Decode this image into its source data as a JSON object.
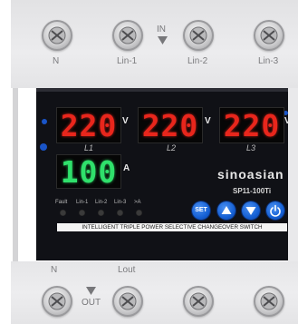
{
  "top_terminals": [
    {
      "label": "N"
    },
    {
      "label": "Lin-1"
    },
    {
      "label": "Lin-2"
    },
    {
      "label": "Lin-3"
    }
  ],
  "input_marker": "IN",
  "displays": {
    "l1": {
      "value": "220",
      "unit": "V",
      "label": "L1"
    },
    "l2": {
      "value": "220",
      "unit": "V",
      "label": "L2"
    },
    "l3": {
      "value": "220",
      "unit": "V",
      "label": "L3"
    },
    "current": {
      "value": "100",
      "unit": "A"
    }
  },
  "indicators": [
    "Fault",
    "Lin-1",
    "Lin-2",
    "Lin-3",
    ">A"
  ],
  "brand": "sinoasian",
  "model": "SP11-100Ti",
  "buttons": {
    "set_label": "SET"
  },
  "banner": "INTELLIGENT TRIPLE POWER SELECTIVE CHANGEOVER SWITCH",
  "bottom_labels": {
    "n": "N",
    "lout": "Lout",
    "out": "OUT"
  },
  "colors": {
    "display_red": "#e8261c",
    "display_green": "#2fe06b",
    "button_blue": "#1560d4"
  }
}
